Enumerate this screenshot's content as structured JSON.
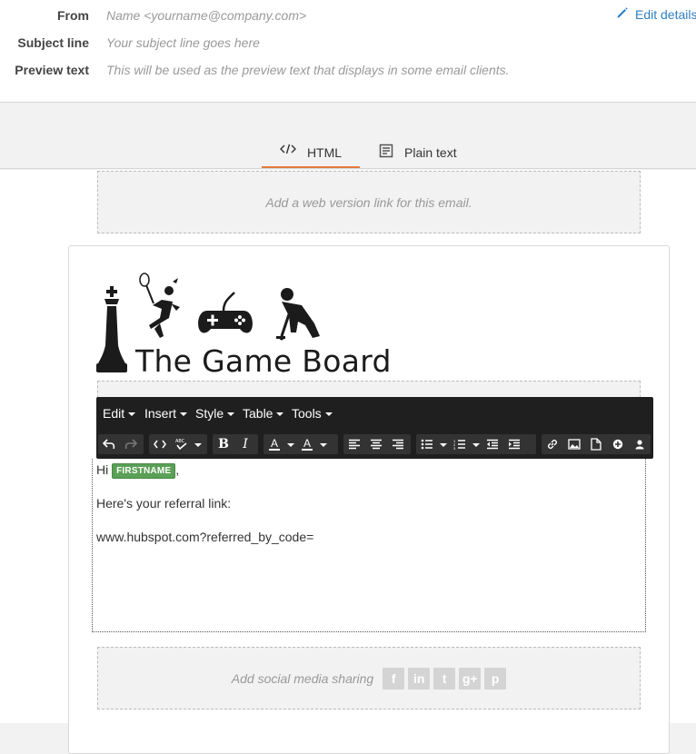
{
  "header": {
    "from_label": "From",
    "from_value": "Name <yourname@company.com>",
    "subject_label": "Subject line",
    "subject_value": "Your subject line goes here",
    "preview_label": "Preview text",
    "preview_value": "This will be used as the preview text that displays in some email clients.",
    "edit_details": "Edit details"
  },
  "tabs": {
    "html": "HTML",
    "plain": "Plain text"
  },
  "editor": {
    "web_version_placeholder": "Add a web version link for this email.",
    "logo_text": "The Game Board",
    "greeting": "Hi",
    "token": "FIRSTNAME",
    "greeting_suffix": ",",
    "line2": "Here's your referral link:",
    "line3": "www.hubspot.com?referred_by_code=",
    "social_placeholder": "Add social media sharing"
  },
  "toolbar": {
    "menus": [
      "Edit",
      "Insert",
      "Style",
      "Table",
      "Tools"
    ]
  },
  "social_icons": [
    "f",
    "in",
    "t",
    "g+",
    "p"
  ],
  "colors": {
    "accent_tab": "#e47a3c",
    "link": "#2f7fc1",
    "token": "#5aa057",
    "toolbar": "#1f1f1f"
  }
}
